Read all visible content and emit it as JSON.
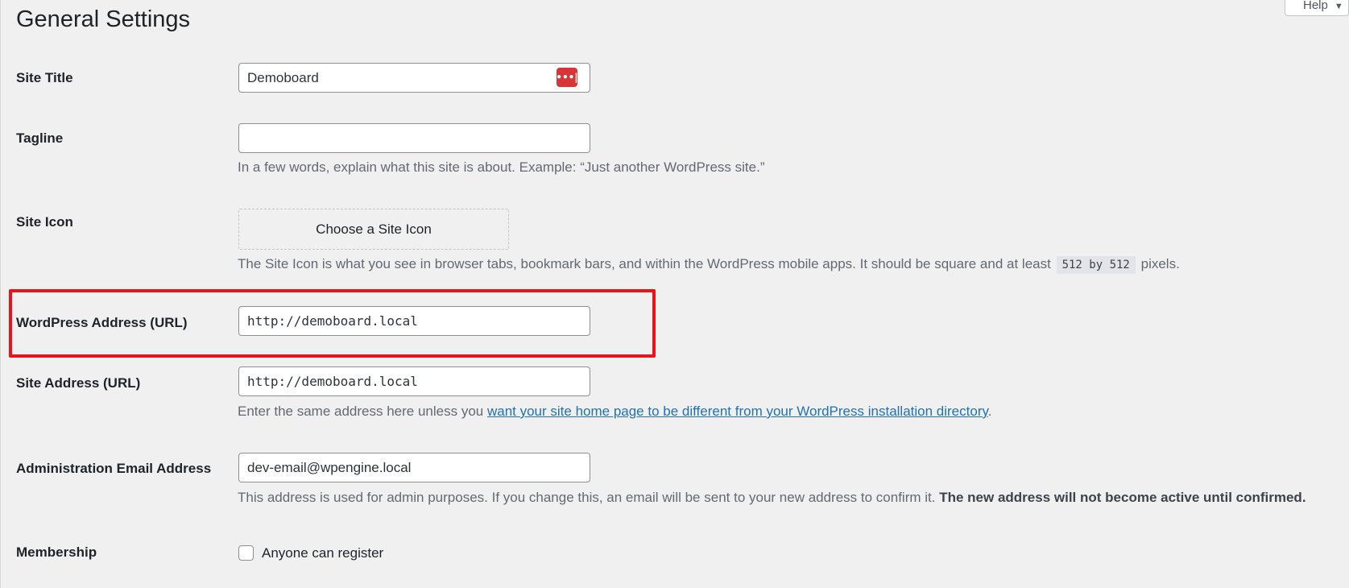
{
  "header": {
    "title": "General Settings",
    "help_label": "Help"
  },
  "fields": {
    "site_title": {
      "label": "Site Title",
      "value": "Demoboard",
      "password_manager_icon": "password-manager-icon"
    },
    "tagline": {
      "label": "Tagline",
      "value": "",
      "description": "In a few words, explain what this site is about. Example: “Just another WordPress site.”"
    },
    "site_icon": {
      "label": "Site Icon",
      "button_label": "Choose a Site Icon",
      "description_before": "The Site Icon is what you see in browser tabs, bookmark bars, and within the WordPress mobile apps. It should be square and at least",
      "size_code": "512 by 512",
      "description_after": "pixels."
    },
    "wordpress_address": {
      "label": "WordPress Address (URL)",
      "value": "http://demoboard.local"
    },
    "site_address": {
      "label": "Site Address (URL)",
      "value": "http://demoboard.local",
      "description_before": "Enter the same address here unless you",
      "link_text": "want your site home page to be different from your WordPress installation directory",
      "description_after": "."
    },
    "admin_email": {
      "label": "Administration Email Address",
      "value": "dev-email@wpengine.local",
      "description": "This address is used for admin purposes. If you change this, an email will be sent to your new address to confirm it.",
      "description_bold": "The new address will not become active until confirmed."
    },
    "membership": {
      "label": "Membership",
      "checkbox_label": "Anyone can register",
      "checked": false
    }
  },
  "colors": {
    "accent_link": "#2271b1",
    "highlight_border": "#e8141c",
    "password_icon_bg": "#d63638"
  }
}
